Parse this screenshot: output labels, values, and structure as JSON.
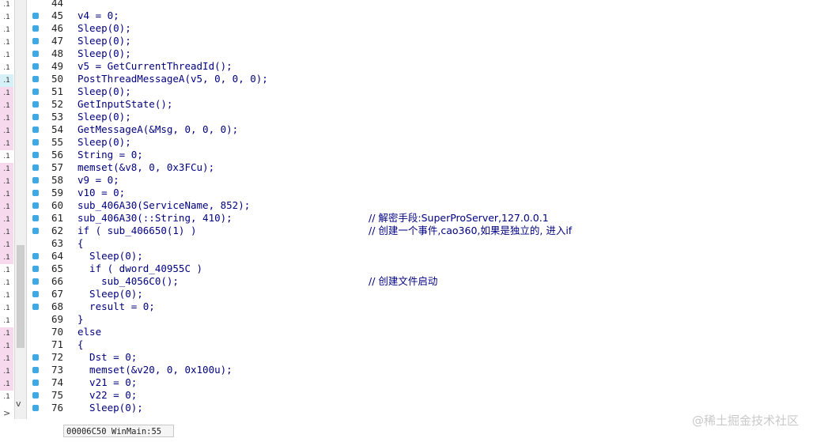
{
  "left_strip": {
    "row_marks": [
      ".1",
      ".1",
      ".1",
      ".1",
      ".1",
      ".1",
      ".1",
      ".1",
      ".1",
      ".1",
      ".1",
      ".1",
      ".1",
      ".1",
      ".1",
      ".1",
      ".1",
      ".1",
      ".1",
      ".1",
      ".1",
      ".1",
      ".1",
      ".1",
      ".1",
      ".1",
      ".1",
      ".1",
      ".1",
      ".1",
      ".1",
      ".1"
    ],
    "bottom_chevron": ">",
    "bottom_dropdown": "v"
  },
  "editor": {
    "lines": [
      {
        "num": "44",
        "bp": false,
        "code": "",
        "comment": ""
      },
      {
        "num": "45",
        "bp": true,
        "code": "v4 = 0;",
        "comment": ""
      },
      {
        "num": "46",
        "bp": true,
        "code": "Sleep(0);",
        "comment": ""
      },
      {
        "num": "47",
        "bp": true,
        "code": "Sleep(0);",
        "comment": ""
      },
      {
        "num": "48",
        "bp": true,
        "code": "Sleep(0);",
        "comment": ""
      },
      {
        "num": "49",
        "bp": true,
        "code": "v5 = GetCurrentThreadId();",
        "comment": ""
      },
      {
        "num": "50",
        "bp": true,
        "code": "PostThreadMessageA(v5, 0, 0, 0);",
        "comment": ""
      },
      {
        "num": "51",
        "bp": true,
        "code": "Sleep(0);",
        "comment": ""
      },
      {
        "num": "52",
        "bp": true,
        "code": "GetInputState();",
        "comment": ""
      },
      {
        "num": "53",
        "bp": true,
        "code": "Sleep(0);",
        "comment": ""
      },
      {
        "num": "54",
        "bp": true,
        "code": "GetMessageA(&Msg, 0, 0, 0);",
        "comment": ""
      },
      {
        "num": "55",
        "bp": true,
        "code": "Sleep(0);",
        "comment": ""
      },
      {
        "num": "56",
        "bp": true,
        "code": "String = 0;",
        "comment": ""
      },
      {
        "num": "57",
        "bp": true,
        "code": "memset(&v8, 0, 0x3FCu);",
        "comment": ""
      },
      {
        "num": "58",
        "bp": true,
        "code": "v9 = 0;",
        "comment": ""
      },
      {
        "num": "59",
        "bp": true,
        "code": "v10 = 0;",
        "comment": ""
      },
      {
        "num": "60",
        "bp": true,
        "code": "sub_406A30(ServiceName, 852);",
        "comment": ""
      },
      {
        "num": "61",
        "bp": true,
        "code": "sub_406A30(::String, 410);",
        "comment": "// 解密手段:SuperProServer,127.0.0.1"
      },
      {
        "num": "62",
        "bp": true,
        "code": "if ( sub_406650(1) )",
        "comment": "// 创建一个事件,cao360,如果是独立的, 进入if"
      },
      {
        "num": "63",
        "bp": false,
        "code": "{",
        "comment": ""
      },
      {
        "num": "64",
        "bp": true,
        "code": "  Sleep(0);",
        "comment": ""
      },
      {
        "num": "65",
        "bp": true,
        "code": "  if ( dword_40955C )",
        "comment": ""
      },
      {
        "num": "66",
        "bp": true,
        "code": "    sub_4056C0();",
        "comment": "// 创建文件启动"
      },
      {
        "num": "67",
        "bp": true,
        "code": "  Sleep(0);",
        "comment": ""
      },
      {
        "num": "68",
        "bp": true,
        "code": "  result = 0;",
        "comment": ""
      },
      {
        "num": "69",
        "bp": false,
        "code": "}",
        "comment": ""
      },
      {
        "num": "70",
        "bp": false,
        "code": "else",
        "comment": ""
      },
      {
        "num": "71",
        "bp": false,
        "code": "{",
        "comment": ""
      },
      {
        "num": "72",
        "bp": true,
        "code": "  Dst = 0;",
        "comment": ""
      },
      {
        "num": "73",
        "bp": true,
        "code": "  memset(&v20, 0, 0x100u);",
        "comment": ""
      },
      {
        "num": "74",
        "bp": true,
        "code": "  v21 = 0;",
        "comment": ""
      },
      {
        "num": "75",
        "bp": true,
        "code": "  v22 = 0;",
        "comment": ""
      },
      {
        "num": "76",
        "bp": true,
        "code": "  Sleep(0);",
        "comment": ""
      }
    ]
  },
  "status_bar": {
    "text": "00006C50 WinMain:55"
  },
  "watermark": {
    "text": "@稀土掘金技术社区"
  },
  "colors": {
    "breakpoint": "#3fa9e6",
    "code": "#000080",
    "comment": "#000080",
    "strip_pink": "#f7d9ee",
    "strip_blue": "#d6f0f7"
  }
}
